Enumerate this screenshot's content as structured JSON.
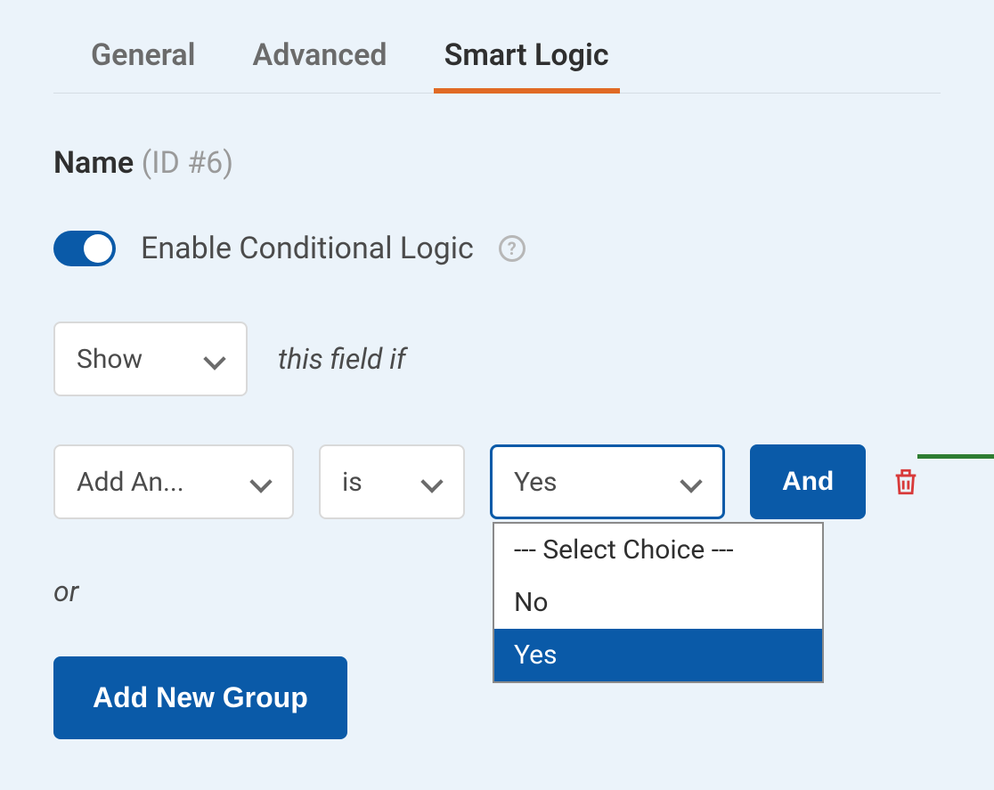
{
  "tabs": {
    "general": "General",
    "advanced": "Advanced",
    "smart_logic": "Smart Logic"
  },
  "field": {
    "name_label": "Name",
    "id_label": "(ID #6)"
  },
  "toggle": {
    "label": "Enable Conditional Logic"
  },
  "rule": {
    "action_value": "Show",
    "hint": "this field if",
    "field_value": "Add An...",
    "operator_value": "is",
    "value_value": "Yes",
    "dropdown": {
      "placeholder": "--- Select Choice ---",
      "opt_no": "No",
      "opt_yes": "Yes"
    },
    "and_label": "And"
  },
  "or_label": "or",
  "add_group_label": "Add New Group"
}
